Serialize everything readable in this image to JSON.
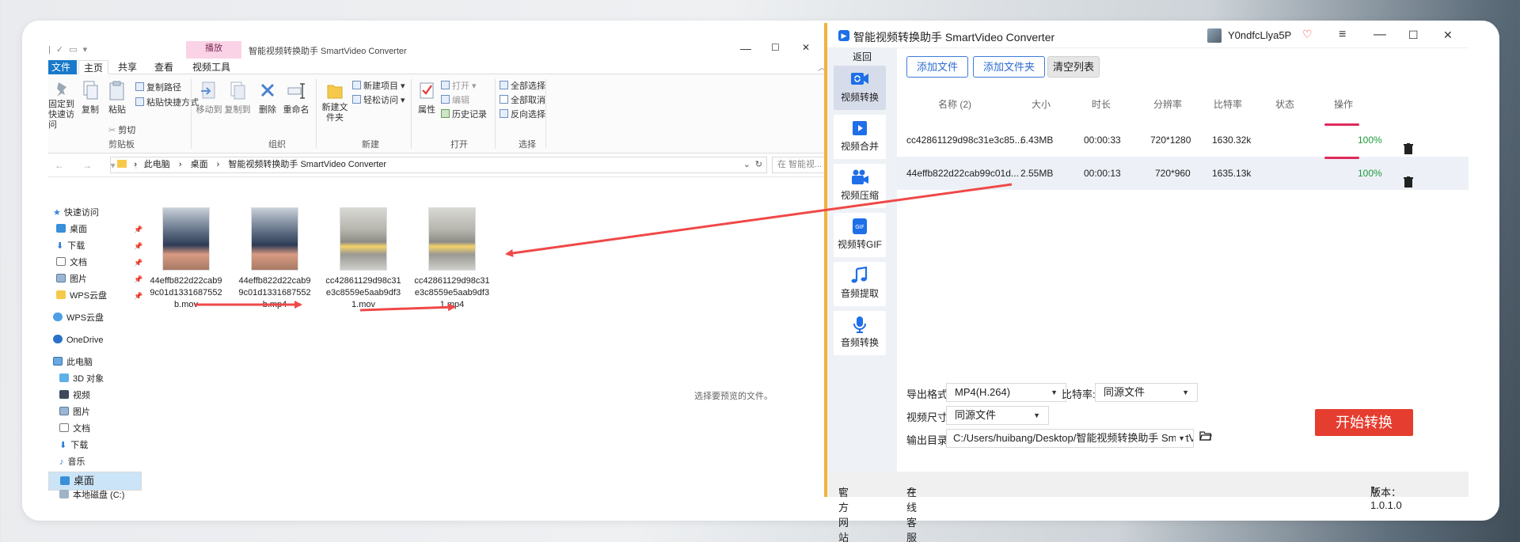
{
  "explorer": {
    "qa_toolbar": "| ✓ ▭ ▾",
    "context_tab": "播放",
    "title": "智能视频转换助手 SmartVideo Converter",
    "window_controls": [
      "—",
      "☐",
      "✕"
    ],
    "tabs": [
      "文件",
      "主页",
      "共享",
      "查看",
      "视频工具"
    ],
    "help": "?",
    "ribbon": {
      "pin_label": "固定到快速访问",
      "copy": "复制",
      "paste": "粘贴",
      "copy_path": "复制路径",
      "paste_shortcut": "粘贴快捷方式",
      "cut": "剪切",
      "group_clipboard": "剪贴板",
      "move_to": "移动到",
      "copy_to": "复制到",
      "delete": "删除",
      "rename": "重命名",
      "group_organize": "组织",
      "new_folder": "新建文件夹",
      "new_item": "新建项目",
      "easy_access": "轻松访问",
      "group_new": "新建",
      "properties": "属性",
      "open": "打开",
      "edit": "编辑",
      "history": "历史记录",
      "group_open": "打开",
      "select_all": "全部选择",
      "select_none": "全部取消",
      "invert": "反向选择",
      "group_select": "选择"
    },
    "address": {
      "nav": "← → ▾ ↑",
      "crumbs": [
        "此电脑",
        "桌面",
        "智能视频转换助手 SmartVideo Converter"
      ],
      "separator": "›",
      "search_placeholder": "在 智能视..."
    },
    "nav_items": [
      {
        "label": "快速访问"
      },
      {
        "label": "桌面"
      },
      {
        "label": "下载"
      },
      {
        "label": "文档"
      },
      {
        "label": "图片"
      },
      {
        "label": "WPS云盘"
      },
      {
        "label": "WPS云盘"
      },
      {
        "label": "OneDrive"
      },
      {
        "label": "此电脑"
      },
      {
        "label": "3D 对象"
      },
      {
        "label": "视频"
      },
      {
        "label": "图片"
      },
      {
        "label": "文档"
      },
      {
        "label": "下载"
      },
      {
        "label": "音乐"
      },
      {
        "label": "桌面"
      },
      {
        "label": "本地磁盘 (C:)"
      }
    ],
    "files": [
      {
        "name": "44effb822d22cab99c01d1331687552b.mov"
      },
      {
        "name": "44effb822d22cab99c01d1331687552b.mp4"
      },
      {
        "name": "cc42861129d98c31e3c8559e5aab9df31.mov"
      },
      {
        "name": "cc42861129d98c31e3c8559e5aab9df31.mp4"
      }
    ],
    "preview_hint": "选择要预览的文件。"
  },
  "converter": {
    "title": "智能视频转换助手 SmartVideo Converter",
    "username": "Y0ndfcLlya5P",
    "window_controls": [
      "≡",
      "—",
      "☐",
      "✕"
    ],
    "back": "返回",
    "sidebar": [
      "视频转换",
      "视频合并",
      "视频压缩",
      "视频转GIF",
      "音频提取",
      "音频转换"
    ],
    "toolbar": {
      "add_file": "添加文件",
      "add_folder": "添加文件夹",
      "clear_list": "清空列表"
    },
    "table": {
      "headers": [
        "名称 (2)",
        "大小",
        "时长",
        "分辨率",
        "比特率",
        "状态",
        "操作"
      ],
      "rows": [
        {
          "name": "cc42861129d98c31e3c85...",
          "size": "6.43MB",
          "duration": "00:00:33",
          "resolution": "720*1280",
          "bitrate": "1630.32k",
          "progress": 1.0,
          "status": "100%"
        },
        {
          "name": "44effb822d22cab99c01d...",
          "size": "2.55MB",
          "duration": "00:00:13",
          "resolution": "720*960",
          "bitrate": "1635.13k",
          "progress": 1.0,
          "status": "100%"
        }
      ]
    },
    "settings": {
      "format_label": "导出格式:",
      "format_value": "MP4(H.264)",
      "bitrate_label": "比特率:",
      "bitrate_value": "同源文件",
      "size_label": "视频尺寸:",
      "size_value": "同源文件",
      "output_label": "输出目录:",
      "output_value": "C:/Users/huibang/Desktop/智能视频转换助手 SmartVideo"
    },
    "start_button": "开始转换",
    "footer": {
      "website": "官方网站",
      "support": "在线客服",
      "version": "版本：1.0.1.0"
    },
    "colors": {
      "accent_blue": "#2d6bd0",
      "start_red": "#e53d2f",
      "progress_red": "#e02a5a",
      "status_green": "#1f9a3a",
      "annotation_arrow": "#f04848"
    }
  }
}
